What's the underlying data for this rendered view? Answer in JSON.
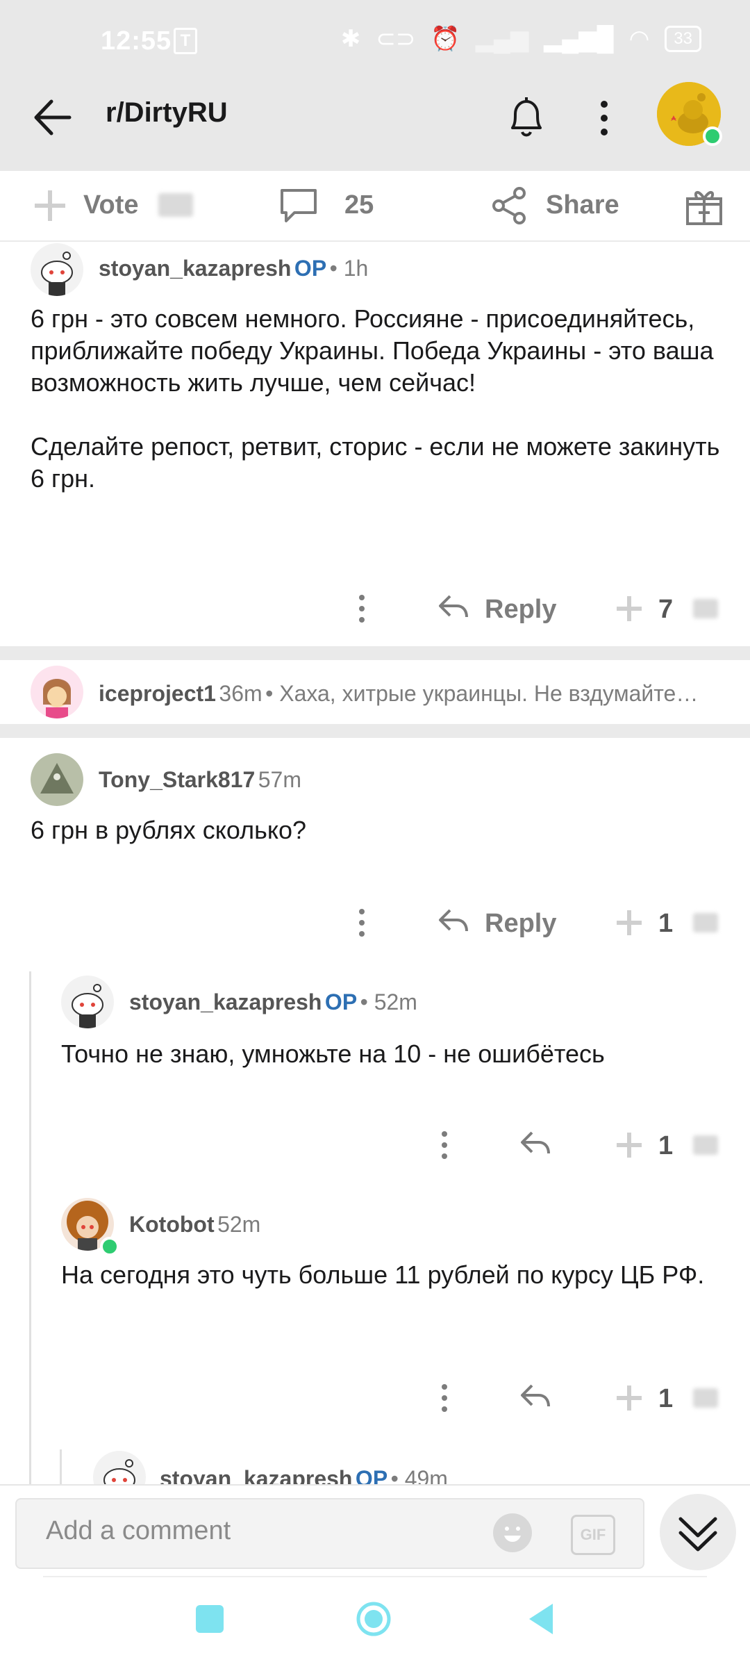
{
  "status_bar": {
    "time": "12:55",
    "carrier_badge": "T",
    "battery": "33",
    "icons": [
      "bluetooth-icon",
      "toggle-icon",
      "alarm-icon",
      "signal-icon",
      "signal-icon",
      "wifi-icon"
    ]
  },
  "header": {
    "title": "r/DirtyRU",
    "accent": "#e8b91a"
  },
  "action_bar": {
    "vote_label": "Vote",
    "comments_count": "25",
    "share_label": "Share"
  },
  "comments": [
    {
      "username": "stoyan_kazapresh",
      "op_badge": "OP",
      "time": "• 1h",
      "body": "6 грн - это совсем немного. Россияне - присоединяйтесь, приближайте победу Украины. Победа Украины - это ваша возможность жить лучше, чем сейчас!\n\nСделайте репост, ретвит, сторис - если не можете закинуть 6 грн.",
      "reply_label": "Reply",
      "votes": "7"
    },
    {
      "username": "iceproject1",
      "time": "36m",
      "collapsed_preview": "• Хаха, хитрые украинцы. Не вздумайте…"
    },
    {
      "username": "Tony_Stark817",
      "time": "57m",
      "body": "6 грн в рублях сколько?",
      "reply_label": "Reply",
      "votes": "1"
    },
    {
      "username": "stoyan_kazapresh",
      "op_badge": "OP",
      "time": "• 52m",
      "body": "Точно не знаю, умножьте на 10 - не ошибётесь",
      "votes": "1"
    },
    {
      "username": "Kotobot",
      "time": "52m",
      "body": "На сегодня это чуть больше 11 рублей по курсу ЦБ РФ.",
      "votes": "1"
    },
    {
      "username": "stoyan_kazapresh",
      "op_badge": "OP",
      "time": "• 49m"
    }
  ],
  "composer": {
    "placeholder": "Add a comment",
    "gif_label": "GIF"
  }
}
